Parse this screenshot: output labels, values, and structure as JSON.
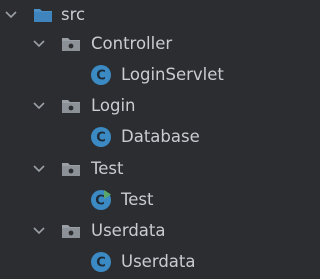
{
  "project_tree": {
    "root": {
      "label": "src",
      "icon": "source-folder-icon",
      "expanded": true
    },
    "packages": [
      {
        "label": "Controller",
        "icon": "package-folder-icon",
        "expanded": true,
        "classes": [
          {
            "label": "LoginServlet",
            "icon": "java-class-icon"
          }
        ]
      },
      {
        "label": "Login",
        "icon": "package-folder-icon",
        "expanded": true,
        "classes": [
          {
            "label": "Database",
            "icon": "java-class-icon"
          }
        ]
      },
      {
        "label": "Test",
        "icon": "package-folder-icon",
        "expanded": true,
        "classes": [
          {
            "label": "Test",
            "icon": "java-runnable-class-icon"
          }
        ]
      },
      {
        "label": "Userdata",
        "icon": "package-folder-icon",
        "expanded": true,
        "classes": [
          {
            "label": "Userdata",
            "icon": "java-class-icon"
          }
        ]
      }
    ],
    "colors": {
      "background": "#2b2d30",
      "text": "#c9ccd1",
      "source_folder": "#4a90c7",
      "package_folder": "#9aa0a6",
      "class_icon": "#3b8ac4",
      "run_marker": "#59a869"
    }
  }
}
